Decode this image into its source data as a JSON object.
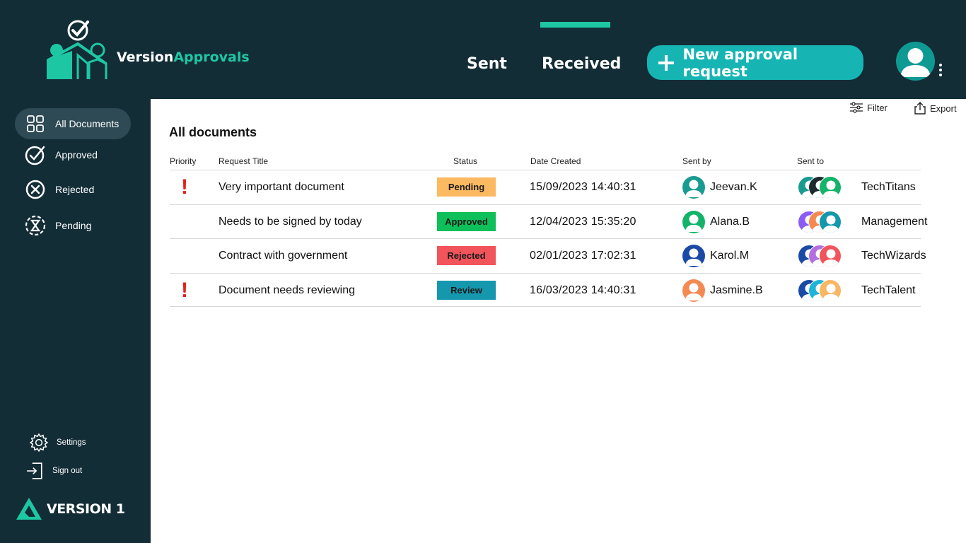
{
  "app": {
    "brand_part1": "Version",
    "brand_part2": "Approvals",
    "footer_logo": "VERSION 1"
  },
  "colors": {
    "background": "#132d37",
    "accent": "#1ec7a4",
    "button": "#16b5b3",
    "pending": "#fbb962",
    "approved": "#0ebf5a",
    "rejected": "#f2545b",
    "review": "#1597ad",
    "priority": "#e2231a"
  },
  "nav": {
    "tabs": [
      {
        "label": "Sent",
        "active": false
      },
      {
        "label": "Received",
        "active": true
      }
    ],
    "new_request_label": "New approval request"
  },
  "sidebar": {
    "items": [
      {
        "label": "All Documents",
        "icon": "grid-icon",
        "active": true
      },
      {
        "label": "Approved",
        "icon": "check-circle-icon",
        "active": false
      },
      {
        "label": "Rejected",
        "icon": "x-circle-icon",
        "active": false
      },
      {
        "label": "Pending",
        "icon": "hourglass-icon",
        "active": false
      }
    ],
    "settings_label": "Settings",
    "signout_label": "Sign out"
  },
  "main": {
    "title": "All documents",
    "filter_label": "Filter",
    "export_label": "Export",
    "columns": [
      "Priority",
      "Request Title",
      "Status",
      "Date Created",
      "Sent by",
      "Sent to"
    ],
    "rows": [
      {
        "priority": "!",
        "title": "Very important document",
        "status": "Pending",
        "status_color": "#fbb962",
        "date": "15/09/2023  14:40:31",
        "sent_by": "Jeevan.K",
        "sender_color": "#1a9b91",
        "group": "TechTitans",
        "group_colors": [
          "#1a9b91",
          "#1d2a30",
          "#14b36a"
        ]
      },
      {
        "priority": "",
        "title": "Needs to be signed by today",
        "status": "Approved",
        "status_color": "#0ebf5a",
        "date": "12/04/2023  15:35:20",
        "sent_by": "Alana.B",
        "sender_color": "#14b36a",
        "group": "Management",
        "group_colors": [
          "#8b5cf6",
          "#f48a52",
          "#1597ad"
        ]
      },
      {
        "priority": "",
        "title": "Contract with government",
        "status": "Rejected",
        "status_color": "#f2545b",
        "date": "02/01/2023  17:02:31",
        "sent_by": "Karol.M",
        "sender_color": "#1a4aa5",
        "group": "TechWizards",
        "group_colors": [
          "#1a4aa5",
          "#b26fe0",
          "#f2545b"
        ]
      },
      {
        "priority": "!",
        "title": "Document needs reviewing",
        "status": "Review",
        "status_color": "#1597ad",
        "date": "16/03/2023  14:40:31",
        "sent_by": "Jasmine.B",
        "sender_color": "#f48a52",
        "group": "TechTalent",
        "group_colors": [
          "#1a4aa5",
          "#1fb4d8",
          "#f9b763"
        ]
      }
    ]
  }
}
